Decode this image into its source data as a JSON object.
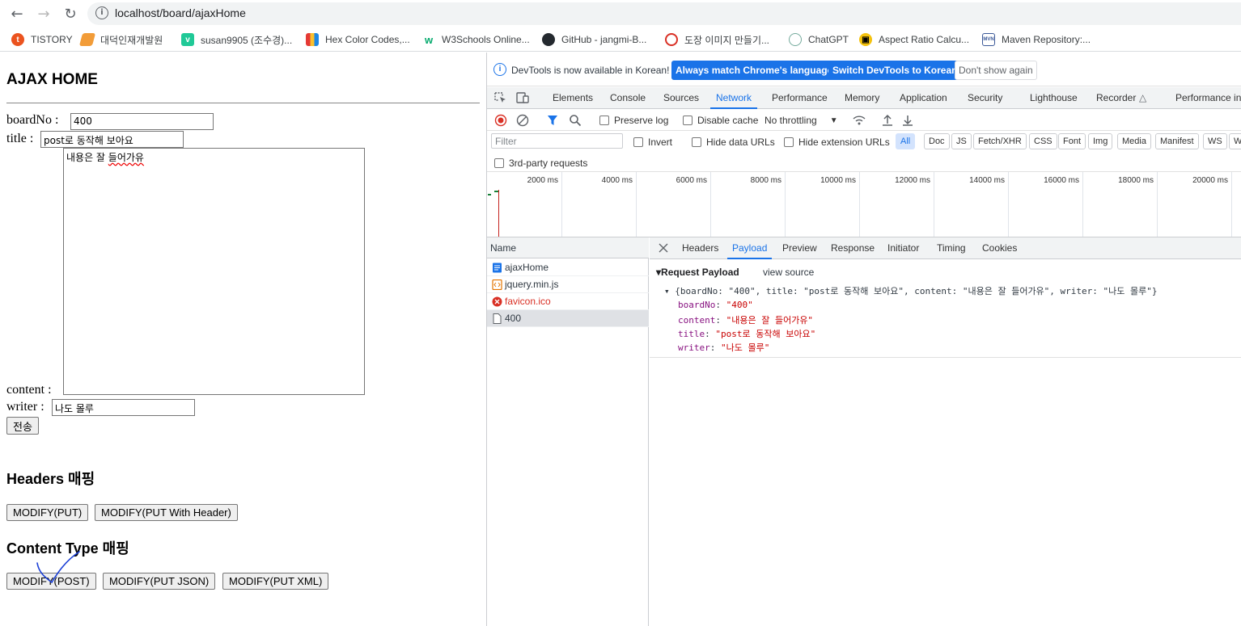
{
  "browser": {
    "url": "localhost/board/ajaxHome",
    "bookmarks": [
      {
        "label": "TISTORY",
        "icon": "tistory-icon",
        "color": "#eb531f"
      },
      {
        "label": "대덕인재개발원",
        "icon": "pencil-icon",
        "color": "#f29c38"
      },
      {
        "label": "susan9905 (조수경)...",
        "icon": "velog-icon",
        "color": "#20c997"
      },
      {
        "label": "Hex Color Codes,...",
        "icon": "color-book-icon",
        "color": "#4b6cb7"
      },
      {
        "label": "W3Schools Online...",
        "icon": "w3schools-icon",
        "color": "#04aa6d"
      },
      {
        "label": "GitHub - jangmi-B...",
        "icon": "github-icon",
        "color": "#24292f"
      },
      {
        "label": "도장 이미지 만들기...",
        "icon": "stamp-icon",
        "color": "#d93025"
      },
      {
        "label": "ChatGPT",
        "icon": "chatgpt-icon",
        "color": "#74aa9c"
      },
      {
        "label": "Aspect Ratio Calcu...",
        "icon": "aspect-ratio-icon",
        "color": "#f4c20d"
      },
      {
        "label": "Maven Repository:...",
        "icon": "maven-icon",
        "color": "#3b5998"
      }
    ]
  },
  "page": {
    "title": "AJAX HOME",
    "form": {
      "boardNo_label": "boardNo :",
      "boardNo_value": "400",
      "title_label": "title :",
      "title_value": "post로 동작해 보아요",
      "content_label": "content :",
      "content_value_a": "내용은 잘 ",
      "content_value_b": "들어가유",
      "writer_label": "writer :",
      "writer_value": "나도 몰루",
      "submit_label": "전송"
    },
    "headers_section": {
      "heading": "Headers 매핑",
      "buttons": [
        "MODIFY(PUT)",
        "MODIFY(PUT With Header)"
      ]
    },
    "content_type_section": {
      "heading": "Content Type 매핑",
      "buttons": [
        "MODIFY(POST)",
        "MODIFY(PUT JSON)",
        "MODIFY(PUT XML)"
      ]
    }
  },
  "devtools": {
    "info_message": "DevTools is now available in Korean!",
    "info_buttons": [
      "Always match Chrome's language",
      "Switch DevTools to Korean",
      "Don't show again"
    ],
    "tabs": [
      "Elements",
      "Console",
      "Sources",
      "Network",
      "Performance",
      "Memory",
      "Application",
      "Security",
      "Lighthouse",
      "Recorder",
      "Performance ins"
    ],
    "active_tab": "Network",
    "toolbar": {
      "preserve_log": "Preserve log",
      "disable_cache": "Disable cache",
      "throttling": "No throttling"
    },
    "filter": {
      "placeholder": "Filter",
      "invert": "Invert",
      "hide_data_urls": "Hide data URLs",
      "hide_extension_urls": "Hide extension URLs",
      "types": [
        "All",
        "Doc",
        "JS",
        "Fetch/XHR",
        "CSS",
        "Font",
        "Img",
        "Media",
        "Manifest",
        "WS",
        "W"
      ],
      "active_type": "All",
      "third_party": "3rd-party requests"
    },
    "timeline_ticks": [
      "2000 ms",
      "4000 ms",
      "6000 ms",
      "8000 ms",
      "10000 ms",
      "12000 ms",
      "14000 ms",
      "16000 ms",
      "18000 ms",
      "20000 ms"
    ],
    "requests": {
      "column_header": "Name",
      "items": [
        {
          "name": "ajaxHome",
          "type": "document"
        },
        {
          "name": "jquery.min.js",
          "type": "script"
        },
        {
          "name": "favicon.ico",
          "type": "error"
        },
        {
          "name": "400",
          "type": "fetch",
          "selected": true
        }
      ]
    },
    "detail": {
      "tabs": [
        "Headers",
        "Payload",
        "Preview",
        "Response",
        "Initiator",
        "Timing",
        "Cookies"
      ],
      "active_tab": "Payload",
      "section_title": "▾Request Payload",
      "view_source": "view source",
      "summary": "▾ {boardNo: \"400\", title: \"post로 동작해 보아요\", content: \"내용은 잘 들어가유\", writer: \"나도 몰루\"}",
      "fields": [
        {
          "key": "boardNo",
          "value": "\"400\""
        },
        {
          "key": "content",
          "value": "\"내용은 잘 들어가유\""
        },
        {
          "key": "title",
          "value": "\"post로 동작해 보아요\""
        },
        {
          "key": "writer",
          "value": "\"나도 몰루\""
        }
      ]
    }
  }
}
